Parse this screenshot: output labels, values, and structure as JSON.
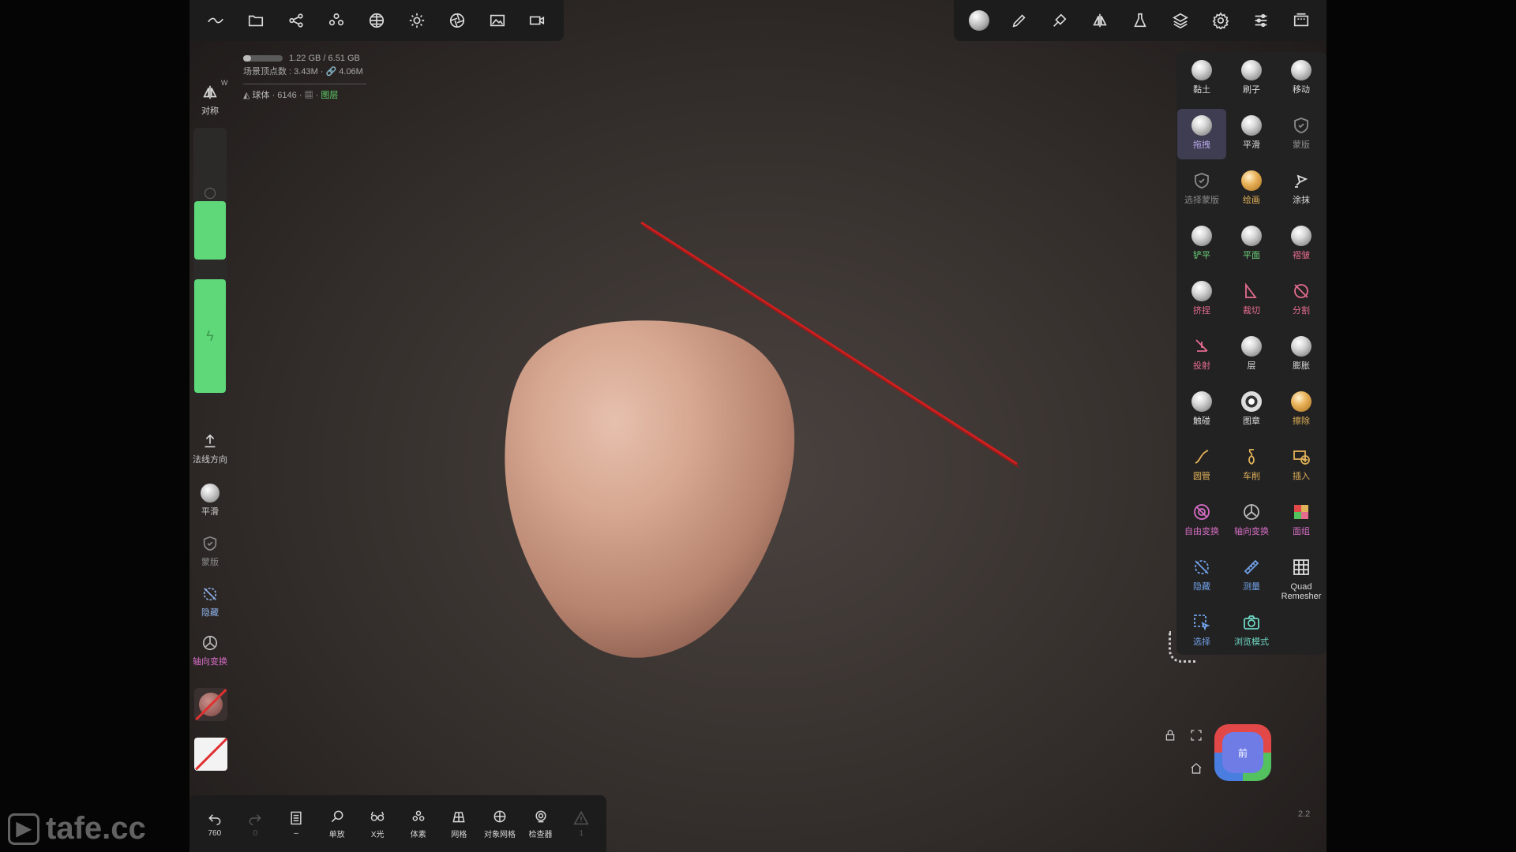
{
  "watermark": {
    "text": "tafe.cc"
  },
  "top_left_toolbar": [
    "wave-icon",
    "folder-icon",
    "share-icon",
    "scene-icon",
    "sphere-grid-icon",
    "sun-icon",
    "aperture-icon",
    "image-icon",
    "camera-icon"
  ],
  "top_right_toolbar": [
    "material-icon",
    "brush-icon",
    "stroke-icon",
    "symmetry-icon",
    "flask-icon",
    "layers-icon",
    "gear-icon",
    "sliders-icon",
    "gallery-icon"
  ],
  "stats": {
    "memory": "1.22 GB / 6.51 GB",
    "memory_used_fraction": 0.19,
    "scene_vertices": "场景顶点数 : 3.43M · 🔗 4.06M",
    "object_name": "球体",
    "object_info": "· 6146 ·",
    "layer_label": "图层"
  },
  "left_panel": {
    "symmetry_label": "对称",
    "symmetry_key": "W",
    "radius_level": 0.33,
    "intensity_level": 1.0,
    "normal_label": "法线方向",
    "smooth_label": "平滑",
    "mask_label": "蒙版",
    "hide_label": "隐藏",
    "axis_label": "轴向变换"
  },
  "tools": [
    {
      "label": "黏土",
      "color": "#dcdcdc",
      "kind": "orb"
    },
    {
      "label": "刷子",
      "color": "#dcdcdc",
      "kind": "orb"
    },
    {
      "label": "移动",
      "color": "#dcdcdc",
      "kind": "orb"
    },
    {
      "label": "拖拽",
      "color": "#b7a7e8",
      "kind": "orb",
      "selected": true
    },
    {
      "label": "平滑",
      "color": "#dcdcdc",
      "kind": "orb"
    },
    {
      "label": "蒙版",
      "color": "#8a8a8a",
      "kind": "shield"
    },
    {
      "label": "选择蒙版",
      "color": "#8a8a8a",
      "kind": "shield"
    },
    {
      "label": "绘画",
      "color": "#e0b259",
      "kind": "orb-orange"
    },
    {
      "label": "涂抹",
      "color": "#dcdcdc",
      "kind": "smudge"
    },
    {
      "label": "铲平",
      "color": "#6dd67c",
      "kind": "orb"
    },
    {
      "label": "平面",
      "color": "#6dd67c",
      "kind": "orb"
    },
    {
      "label": "褶皱",
      "color": "#e56c8f",
      "kind": "orb"
    },
    {
      "label": "挤捏",
      "color": "#e56c8f",
      "kind": "orb"
    },
    {
      "label": "裁切",
      "color": "#e56c8f",
      "kind": "trim"
    },
    {
      "label": "分割",
      "color": "#e56c8f",
      "kind": "split"
    },
    {
      "label": "投射",
      "color": "#e56c8f",
      "kind": "project"
    },
    {
      "label": "层",
      "color": "#dcdcdc",
      "kind": "orb"
    },
    {
      "label": "膨胀",
      "color": "#dcdcdc",
      "kind": "orb"
    },
    {
      "label": "触碰",
      "color": "#dcdcdc",
      "kind": "orb"
    },
    {
      "label": "图章",
      "color": "#dcdcdc",
      "kind": "orb-dark"
    },
    {
      "label": "擦除",
      "color": "#e0b259",
      "kind": "orb-orange"
    },
    {
      "label": "圆管",
      "color": "#e0b259",
      "kind": "tube"
    },
    {
      "label": "车削",
      "color": "#e0b259",
      "kind": "lathe"
    },
    {
      "label": "插入",
      "color": "#e0b259",
      "kind": "insert"
    },
    {
      "label": "自由变换",
      "color": "#d76ec7",
      "kind": "transform"
    },
    {
      "label": "轴向变换",
      "color": "#d76ec7",
      "kind": "gizmo"
    },
    {
      "label": "面组",
      "color": "#d76ec7",
      "kind": "facegroup"
    },
    {
      "label": "隐藏",
      "color": "#6fa0e6",
      "kind": "hide"
    },
    {
      "label": "测量",
      "color": "#6fa0e6",
      "kind": "ruler"
    },
    {
      "label": "Quad Remesher",
      "color": "#dcdcdc",
      "kind": "grid"
    },
    {
      "label": "选择",
      "color": "#6fa0e6",
      "kind": "select"
    },
    {
      "label": "浏览模式",
      "color": "#6dd6c4",
      "kind": "camera"
    }
  ],
  "bottom_bar": [
    {
      "label": "760",
      "icon": "undo-icon"
    },
    {
      "label": "0",
      "icon": "redo-icon",
      "dim": true
    },
    {
      "label": "–",
      "icon": "doc-icon"
    },
    {
      "label": "单放",
      "icon": "magnifier-icon"
    },
    {
      "label": "X光",
      "icon": "xray-glasses-icon"
    },
    {
      "label": "体素",
      "icon": "voxel-icon"
    },
    {
      "label": "网格",
      "icon": "wireframe-icon"
    },
    {
      "label": "对象网格",
      "icon": "object-mesh-icon"
    },
    {
      "label": "检查器",
      "icon": "inspector-icon"
    },
    {
      "label": "1",
      "icon": "warning-icon",
      "dim": true
    }
  ],
  "nav_cube": {
    "face_label": "前"
  },
  "version": "2.2",
  "colors": {
    "accent_green": "#5fd87a",
    "selected_tool": "#3e3d52",
    "panel": "#232222",
    "mesh": "#c99a88"
  }
}
